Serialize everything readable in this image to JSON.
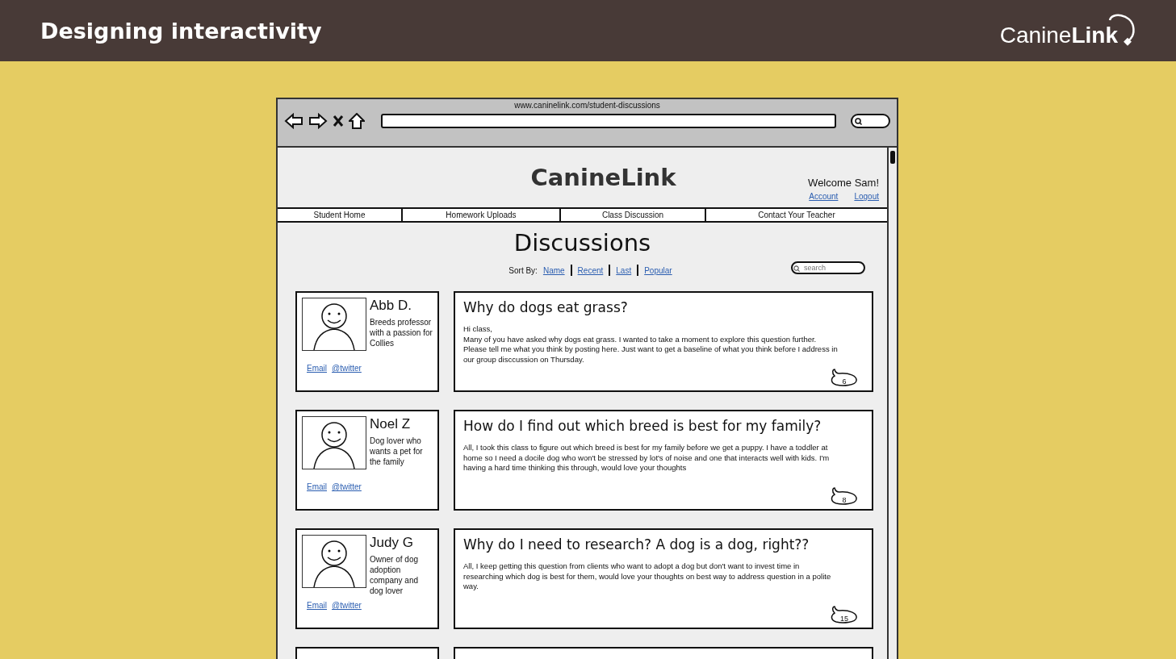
{
  "slide": {
    "title": "Designing interactivity",
    "logo": "Canine**Link**"
  },
  "browser": {
    "url": "www.caninelink.com/student-discussions"
  },
  "site": {
    "title": "CanineLink",
    "welcome": "Welcome Sam!",
    "links": [
      "Account",
      "Logout"
    ],
    "nav": [
      "Student Home",
      "Homework Uploads",
      "Class Discussion",
      "Contact Your Teacher"
    ]
  },
  "page": {
    "heading": "Discussions",
    "sort_label": "Sort By:",
    "sort_options": [
      "Name",
      "Recent",
      "Last",
      "Popular"
    ],
    "search": {
      "placeholder": "search"
    }
  },
  "posts": [
    {
      "author": "Abb D.",
      "bio": "Breeds professor with a passion for Collies",
      "links": [
        "Email",
        "@twitter"
      ],
      "title": "Why do dogs eat grass?",
      "body": [
        "Hi class,",
        "Many of you have asked why dogs eat grass. I wanted to take a moment to explore this question further. Please tell me what you think by posting here. Just want to get a baseline of what you think before I address in our group disccussion on Thursday."
      ],
      "replies": "6"
    },
    {
      "author": "Noel Z",
      "bio": "Dog lover who wants a pet for the family",
      "links": [
        "Email",
        "@twitter"
      ],
      "title": "How do I find out which breed is best for my family?",
      "body": [
        "All, I took this class to figure out which breed is best for my family before we get a puppy. I have a toddler at home so I need a docile dog who won't be stressed by lot's of noise and one that interacts well with kids. I'm having a hard time thinking this through, would love your thoughts"
      ],
      "replies": "8"
    },
    {
      "author": "Judy G",
      "bio": "Owner of dog adoption company and dog lover",
      "links": [
        "Email",
        "@twitter"
      ],
      "title": "Why do I need to research? A dog is a dog, right??",
      "body": [
        "All, I keep getting this question from clients who want to adopt a dog but don't want to invest time in researching which dog is best for them, would love your thoughts on best way to address question in a polite way."
      ],
      "replies": "15"
    }
  ]
}
